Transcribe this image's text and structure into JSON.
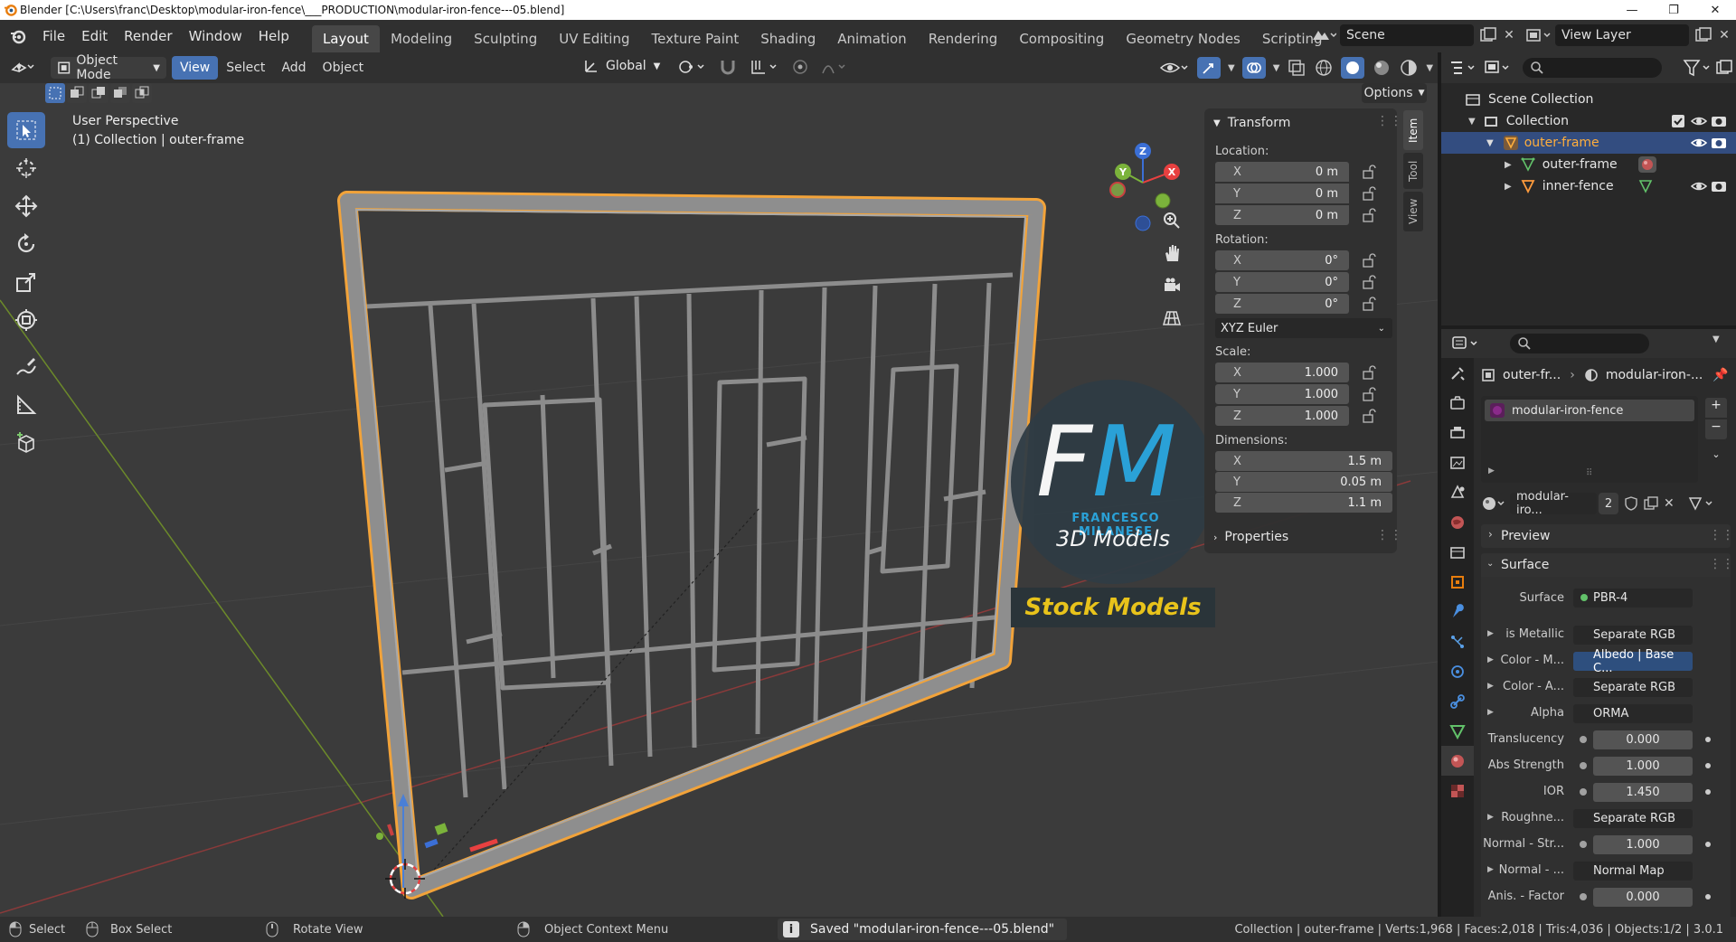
{
  "window": {
    "title": "Blender [C:\\Users\\franc\\Desktop\\modular-iron-fence\\___PRODUCTION\\modular-iron-fence---05.blend]",
    "minimize": "—",
    "maximize": "❐",
    "close": "✕"
  },
  "menubar": {
    "menus": [
      "File",
      "Edit",
      "Render",
      "Window",
      "Help"
    ],
    "workspaces": [
      "Layout",
      "Modeling",
      "Sculpting",
      "UV Editing",
      "Texture Paint",
      "Shading",
      "Animation",
      "Rendering",
      "Compositing",
      "Geometry Nodes",
      "Scripting"
    ],
    "add_workspace": "+",
    "scene": "Scene",
    "view_layer": "View Layer"
  },
  "viewport_header": {
    "mode": "Object Mode",
    "menus": [
      "View",
      "Select",
      "Add",
      "Object"
    ],
    "transform_orientation": "Global",
    "options": "Options"
  },
  "viewport": {
    "perspective": "User Perspective",
    "collection_info": "(1) Collection | outer-frame",
    "gizmo": {
      "x": "X",
      "y": "Y",
      "z": "Z"
    },
    "watermark": {
      "initials_f": "F",
      "initials_m": "M",
      "name": "FRANCESCO MILANESE",
      "tagline": "3D Models",
      "banner": "Stock Models"
    }
  },
  "npanel": {
    "tabs": [
      "Item",
      "Tool",
      "View"
    ],
    "transform_title": "Transform",
    "location_label": "Location:",
    "location": [
      {
        "axis": "X",
        "value": "0 m"
      },
      {
        "axis": "Y",
        "value": "0 m"
      },
      {
        "axis": "Z",
        "value": "0 m"
      }
    ],
    "rotation_label": "Rotation:",
    "rotation": [
      {
        "axis": "X",
        "value": "0°"
      },
      {
        "axis": "Y",
        "value": "0°"
      },
      {
        "axis": "Z",
        "value": "0°"
      }
    ],
    "rotation_mode": "XYZ Euler",
    "scale_label": "Scale:",
    "scale": [
      {
        "axis": "X",
        "value": "1.000"
      },
      {
        "axis": "Y",
        "value": "1.000"
      },
      {
        "axis": "Z",
        "value": "1.000"
      }
    ],
    "dimensions_label": "Dimensions:",
    "dimensions": [
      {
        "axis": "X",
        "value": "1.5 m"
      },
      {
        "axis": "Y",
        "value": "0.05 m"
      },
      {
        "axis": "Z",
        "value": "1.1 m"
      }
    ],
    "properties_title": "Properties"
  },
  "outliner": {
    "scene_collection": "Scene Collection",
    "collection": "Collection",
    "items": [
      {
        "name": "outer-frame",
        "selected": true
      },
      {
        "name": "outer-frame",
        "selected": false
      },
      {
        "name": "inner-fence",
        "selected": false
      }
    ]
  },
  "properties": {
    "breadcrumb_object": "outer-fr...",
    "breadcrumb_material": "modular-iron-...",
    "material_slot": "modular-iron-fence",
    "material_name": "modular-iro...",
    "material_users": "2",
    "preview_title": "Preview",
    "surface_title": "Surface",
    "surface_label": "Surface",
    "surface_shader": "PBR-4",
    "inputs": [
      {
        "label": "is Metallic",
        "value": "Separate RGB",
        "expand": true,
        "numeric": false
      },
      {
        "label": "Color - M...",
        "value": "Albedo | Base C...",
        "expand": true,
        "numeric": false
      },
      {
        "label": "Color - A...",
        "value": "Separate RGB",
        "expand": true,
        "numeric": false
      },
      {
        "label": "Alpha",
        "value": "ORMA",
        "expand": true,
        "numeric": false
      },
      {
        "label": "Translucency",
        "value": "0.000",
        "expand": false,
        "numeric": true
      },
      {
        "label": "Abs Strength",
        "value": "1.000",
        "expand": false,
        "numeric": true
      },
      {
        "label": "IOR",
        "value": "1.450",
        "expand": false,
        "numeric": true
      },
      {
        "label": "Roughne...",
        "value": "Separate RGB",
        "expand": true,
        "numeric": false
      },
      {
        "label": "Normal - Str...",
        "value": "1.000",
        "expand": false,
        "numeric": true
      },
      {
        "label": "Normal - ...",
        "value": "Normal Map",
        "expand": true,
        "numeric": false
      },
      {
        "label": "Anis. - Factor",
        "value": "0.000",
        "expand": false,
        "numeric": true
      }
    ]
  },
  "statusbar": {
    "select": "Select",
    "box_select": "Box Select",
    "rotate_view": "Rotate View",
    "context_menu": "Object Context Menu",
    "message": "Saved \"modular-iron-fence---05.blend\"",
    "stats": "Collection | outer-frame | Verts:1,968 | Faces:2,018 | Tris:4,036 | Objects:1/2 | 3.0.1"
  },
  "colors": {
    "accent": "#4772b3",
    "selection_outline": "#f2a33a",
    "active_object": "#ffae3c",
    "watermark_blue": "#2aa7e0",
    "banner_yellow": "#e8c31b"
  }
}
